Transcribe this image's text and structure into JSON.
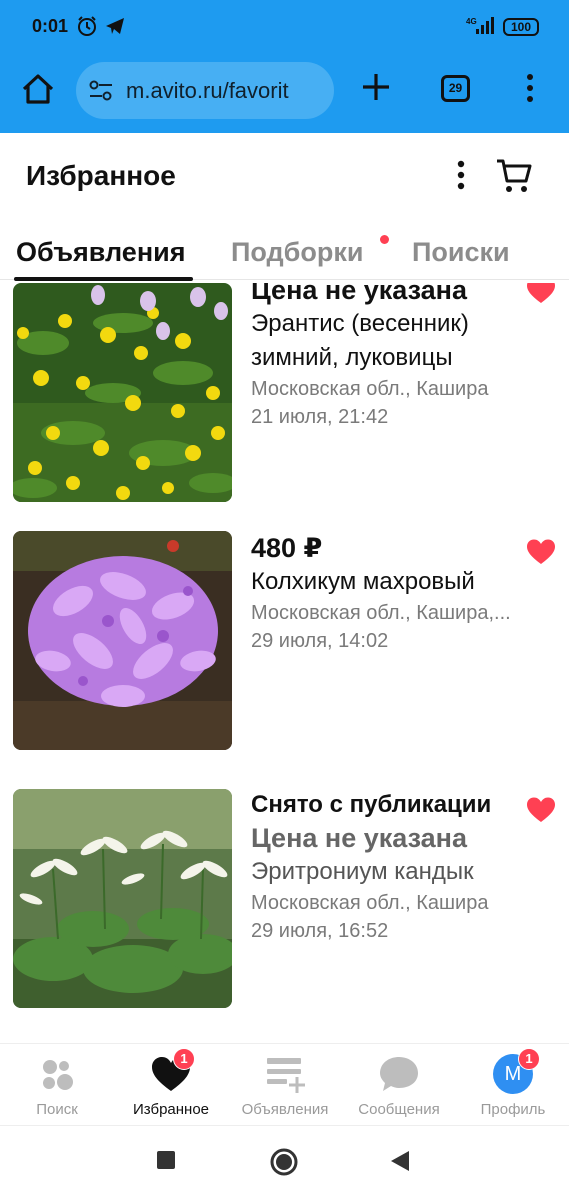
{
  "statusbar": {
    "time": "0:01",
    "network": "4G",
    "battery": "100"
  },
  "browser": {
    "url": "m.avito.ru/favorit",
    "tab_count": "29"
  },
  "page": {
    "title": "Избранное"
  },
  "tabs": [
    {
      "label": "Объявления",
      "active": true
    },
    {
      "label": "Подборки",
      "active": false,
      "has_dot": true
    },
    {
      "label": "Поиски",
      "active": false
    }
  ],
  "listings": [
    {
      "status": "",
      "price": "Цена не указана",
      "title": "Эрантис (весенник) зимний, луковицы",
      "location": "Московская обл., Кашира",
      "date": "21 июля, 21:42",
      "favorite": true,
      "image": "yellow-flowers"
    },
    {
      "status": "",
      "price": "480 ₽",
      "title": "Колхикум махровый",
      "location": "Московская обл., Кашира,...",
      "date": "29 июля, 14:02",
      "favorite": true,
      "image": "purple-flowers"
    },
    {
      "status": "Снято с публикации",
      "price": "Цена не указана",
      "title": "Эритрониум кандык",
      "location": "Московская обл., Кашира",
      "date": "29 июля, 16:52",
      "favorite": true,
      "image": "white-flowers"
    }
  ],
  "bottom_nav": [
    {
      "label": "Поиск",
      "icon": "search-bubbles-icon",
      "active": false
    },
    {
      "label": "Избранное",
      "icon": "heart-icon",
      "active": true,
      "badge": "1"
    },
    {
      "label": "Объявления",
      "icon": "add-listing-icon",
      "active": false
    },
    {
      "label": "Сообщения",
      "icon": "chat-bubble-icon",
      "active": false
    },
    {
      "label": "Профиль",
      "icon": "avatar",
      "active": false,
      "badge": "1",
      "avatar_letter": "М"
    }
  ],
  "colors": {
    "accent": "#1e9bf0",
    "favorite": "#ff4053",
    "avatar": "#2f8ff2"
  }
}
